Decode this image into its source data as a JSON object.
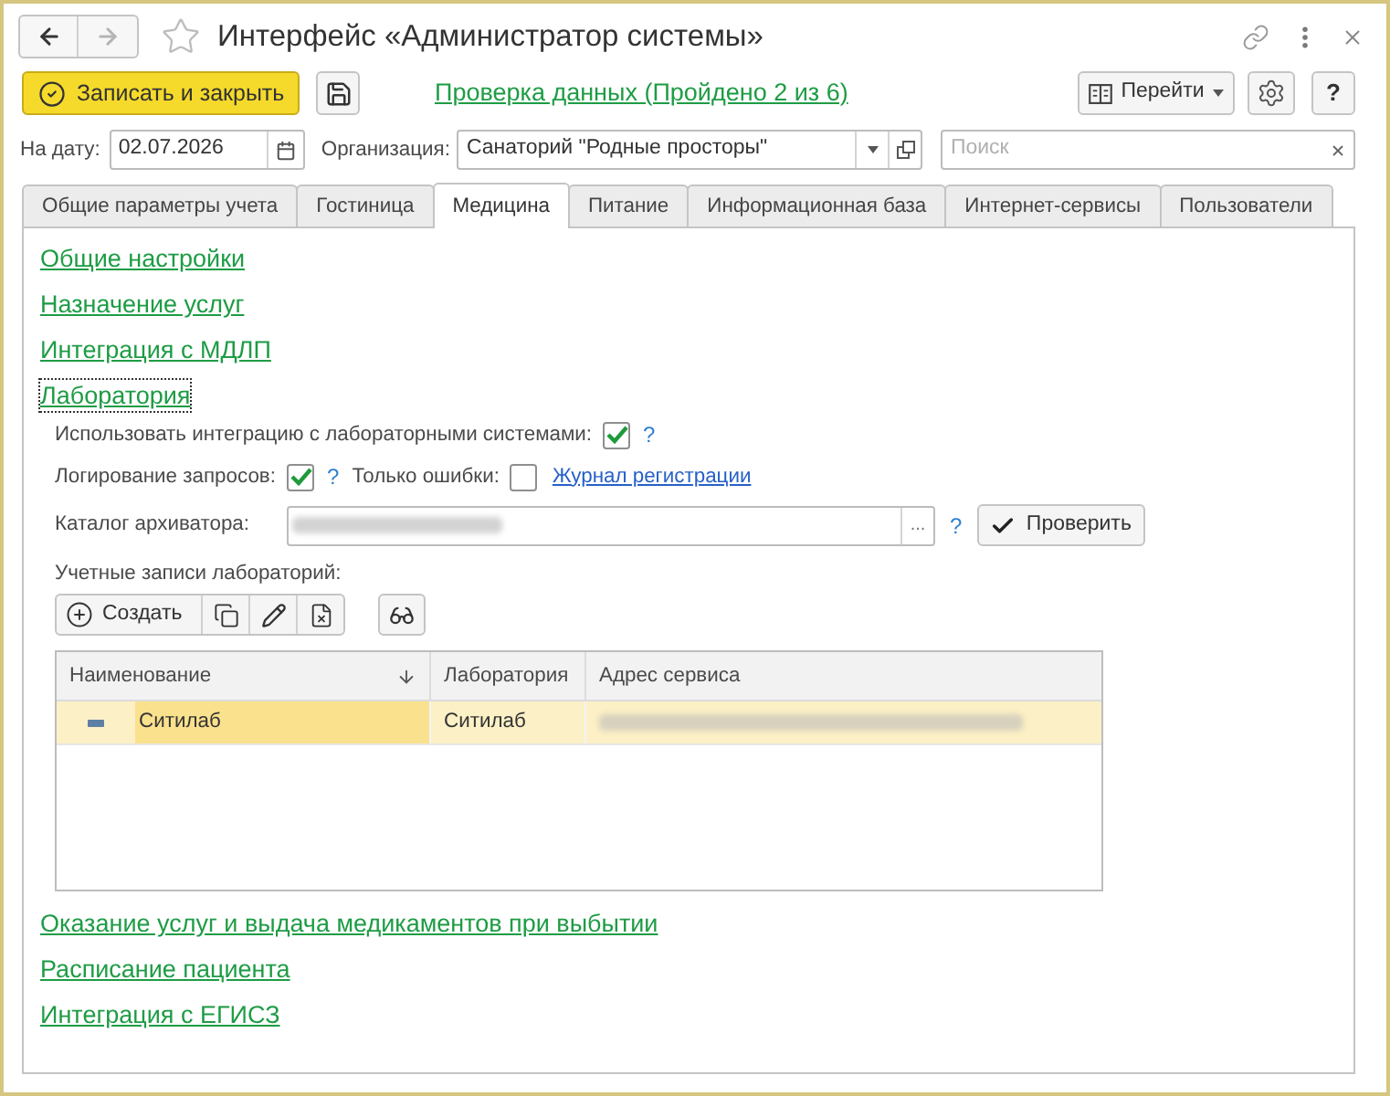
{
  "window": {
    "title": "Интерфейс «Администратор системы»",
    "favorite": false,
    "back_disabled": false,
    "forward_disabled": true
  },
  "toolbar": {
    "save_close_button": "Записать и закрыть",
    "check_link": "Проверка данных (Пройдено 2 из 6)",
    "goto_button": "Перейти",
    "help_button": "?"
  },
  "filters": {
    "date_label": "На дату:",
    "date_value": "02.07.2026",
    "organization_label": "Организация:",
    "organization_value": "Санаторий \"Родные просторы\"",
    "search_placeholder": "Поиск"
  },
  "tabs": [
    {
      "label": "Общие параметры учета",
      "selected": false
    },
    {
      "label": "Гостиница",
      "selected": false
    },
    {
      "label": "Медицина",
      "selected": true
    },
    {
      "label": "Питание",
      "selected": false
    },
    {
      "label": "Информационная база",
      "selected": false
    },
    {
      "label": "Интернет-сервисы",
      "selected": false
    },
    {
      "label": "Пользователи",
      "selected": false
    }
  ],
  "sections_top": [
    {
      "label": "Общие настройки",
      "focused": false
    },
    {
      "label": "Назначение услуг",
      "focused": false
    },
    {
      "label": "Интеграция с МДЛП",
      "focused": false
    },
    {
      "label": "Лаборатория",
      "focused": true
    }
  ],
  "laboratory": {
    "integration": {
      "label": "Использовать интеграцию с лабораторными системами:",
      "checked": true,
      "help": "?"
    },
    "logging": {
      "label": "Логирование запросов:",
      "checked": true,
      "help": "?"
    },
    "errors_only": {
      "label": "Только ошибки:",
      "checked": false
    },
    "journal_link": "Журнал регистрации",
    "archiver": {
      "label": "Каталог архиватора:",
      "select_button": "...",
      "help": "?",
      "check_button": "Проверить"
    },
    "accounts": {
      "label": "Учетные записи лабораторий:",
      "create_button": "Создать",
      "columns": [
        "Наименование",
        "Лаборатория",
        "Адрес сервиса"
      ],
      "rows": [
        {
          "name": "Ситилаб",
          "laboratory": "Ситилаб",
          "selected": true
        }
      ]
    }
  },
  "sections_bottom": [
    {
      "label": "Оказание услуг и выдача медикаментов при выбытии",
      "focused": false
    },
    {
      "label": "Расписание пациента",
      "focused": false
    },
    {
      "label": "Интеграция с ЕГИСЗ",
      "focused": false
    }
  ]
}
